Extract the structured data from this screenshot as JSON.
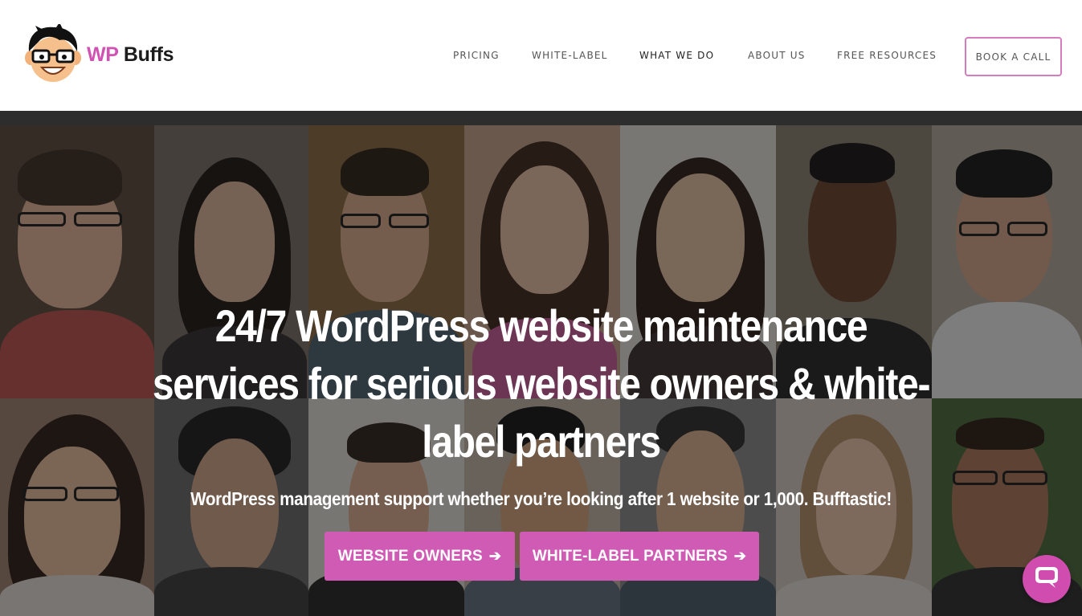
{
  "brand": {
    "name_part1": "WP",
    "name_part2": "Buffs",
    "accent_color": "#d052b2"
  },
  "nav": {
    "items": [
      {
        "label": "PRICING"
      },
      {
        "label": "WHITE-LABEL"
      },
      {
        "label": "WHAT WE DO",
        "active": true
      },
      {
        "label": "ABOUT US"
      },
      {
        "label": "FREE RESOURCES"
      }
    ],
    "cta_label": "BOOK A CALL"
  },
  "hero": {
    "title": "24/7 WordPress website maintenance services for serious website owners & white-label partners",
    "subtitle": "WordPress management support whether you’re looking after 1 website or 1,000. Bufftastic!",
    "buttons": [
      {
        "label": "WEBSITE OWNERS",
        "icon": "arrow-right-icon"
      },
      {
        "label": "WHITE-LABEL PARTNERS",
        "icon": "arrow-right-icon"
      }
    ],
    "button_color": "#cf5bb5",
    "background": "team-photo-grid"
  },
  "chat": {
    "icon": "chat-bubble-icon",
    "color": "#d04cae"
  }
}
